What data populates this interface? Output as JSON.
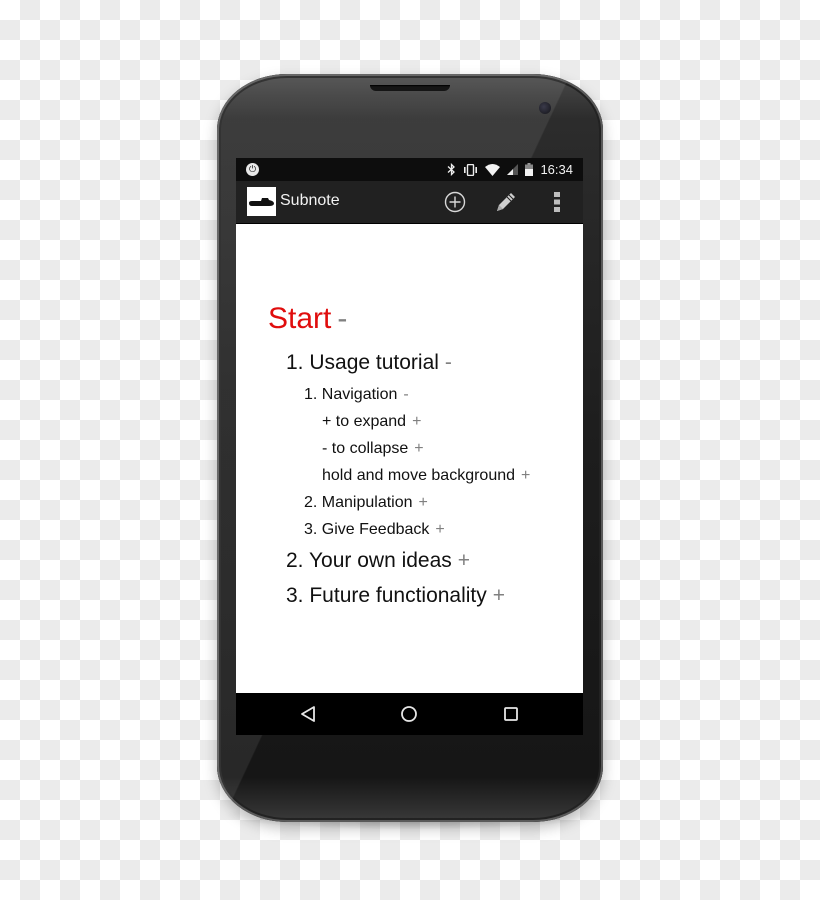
{
  "status_bar": {
    "left_icons": [
      "power-icon"
    ],
    "right_icons": [
      "bluetooth-icon",
      "vibrate-icon",
      "wifi-icon",
      "cell-signal-icon",
      "battery-icon"
    ],
    "time": "16:34"
  },
  "app_bar": {
    "title": "Subnote",
    "logo_icon": "submarine-icon",
    "actions": [
      {
        "name": "add",
        "icon": "add-circle-icon"
      },
      {
        "name": "edit",
        "icon": "pencil-icon"
      },
      {
        "name": "overflow",
        "icon": "more-vert-icon"
      }
    ]
  },
  "outline": {
    "root": {
      "label": "Start",
      "toggle": "-",
      "color": "#e00d0d"
    },
    "items": [
      {
        "label": "1. Usage tutorial",
        "toggle": "-",
        "level": 1
      },
      {
        "label": "1. Navigation",
        "toggle": "-",
        "level": 2
      },
      {
        "label": "+ to expand",
        "toggle": "+",
        "level": 3
      },
      {
        "label": "- to collapse",
        "toggle": "+",
        "level": 3
      },
      {
        "label": "hold and move background",
        "toggle": "+",
        "level": 3
      },
      {
        "label": "2. Manipulation",
        "toggle": "+",
        "level": 2
      },
      {
        "label": "3. Give Feedback",
        "toggle": "+",
        "level": 2
      },
      {
        "label": "2. Your own ideas",
        "toggle": "+",
        "level": 1
      },
      {
        "label": "3. Future functionality",
        "toggle": "+",
        "level": 1
      }
    ]
  },
  "nav_bar": {
    "buttons": [
      {
        "name": "back",
        "icon": "back-triangle-icon"
      },
      {
        "name": "home",
        "icon": "home-circle-icon"
      },
      {
        "name": "recents",
        "icon": "recents-square-icon"
      }
    ]
  }
}
